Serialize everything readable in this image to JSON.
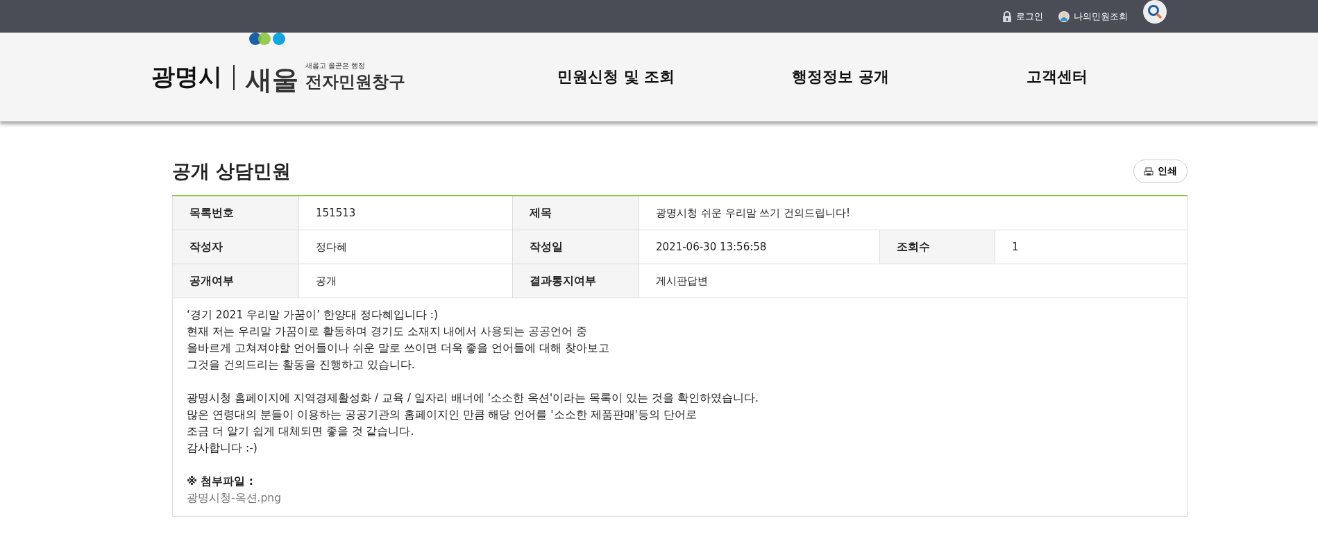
{
  "top_bar": {
    "links": [
      {
        "kind": "login",
        "label": "로그인"
      },
      {
        "kind": "my",
        "label": "나의민원조회"
      }
    ]
  },
  "header": {
    "logo": {
      "city": "광명시",
      "brand": "새울",
      "tagline": "새롭고 올곧은 행정",
      "service": "전자민원창구"
    },
    "nav": [
      "민원신청 및 조회",
      "행정정보 공개",
      "고객센터"
    ]
  },
  "page": {
    "title": "공개 상담민원",
    "print_button": "인쇄"
  },
  "info_table": {
    "rows": [
      [
        {
          "label": "목록번호",
          "value": "151513"
        },
        {
          "label": "제목",
          "value": "광명시청 쉬운 우리말 쓰기 건의드립니다!"
        }
      ],
      [
        {
          "label": "작성자",
          "value": "정다혜"
        },
        {
          "label": "작성일",
          "value": "2021-06-30 13:56:58"
        },
        {
          "label": "조회수",
          "value": "1"
        }
      ],
      [
        {
          "label": "공개여부",
          "value": "공개"
        },
        {
          "label": "결과통지여부",
          "value": "게시판답변"
        }
      ]
    ]
  },
  "body": {
    "paragraphs": [
      [
        "‘경기 2021 우리말 가꿈이’ 한양대 정다혜입니다 :)",
        "현재 저는 우리말 가꿈이로 활동하며 경기도 소재지 내에서 사용되는 공공언어 중",
        "올바르게 고쳐져야할 언어들이나 쉬운 말로 쓰이면 더욱 좋을 언어들에 대해 찾아보고",
        "그것을 건의드리는 활동을 진행하고 있습니다."
      ],
      [
        "광명시청 홈페이지에 지역경제활성화 / 교육 / 일자리 배너에 '소소한 옥션'이라는 목록이 있는 것을 확인하였습니다.",
        "많은 연령대의 분들이 이용하는 공공기관의 홈페이지인 만큼 해당 언어를 '소소한 제품판매'등의 단어로",
        "조금 더 알기 쉽게 대체되면 좋을 것 같습니다.",
        "감사합니다 :-)"
      ]
    ],
    "attachment_label": "※ 첨부파일 :",
    "attachment_file": "광명시청-옥션.png"
  }
}
